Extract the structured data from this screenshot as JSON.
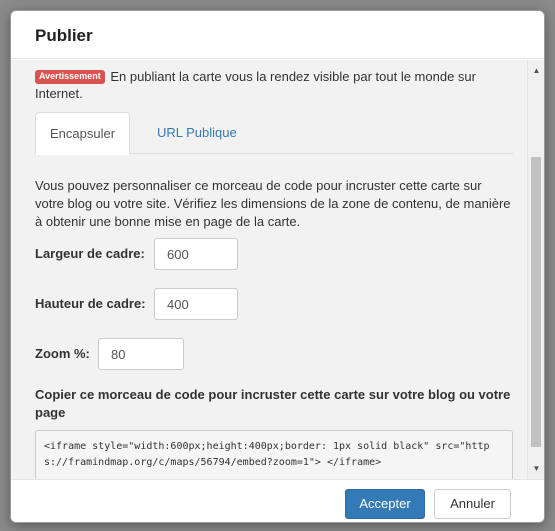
{
  "dialog": {
    "title": "Publier"
  },
  "warning": {
    "badge": "Avertissement",
    "text": "En publiant la carte vous la rendez visible par tout le monde sur Internet."
  },
  "tabs": [
    {
      "label": "Encapsuler",
      "active": true
    },
    {
      "label": "URL Publique",
      "active": false
    }
  ],
  "embed": {
    "description": "Vous pouvez personnaliser ce morceau de code pour incruster cette carte sur votre blog ou votre site. Vérifiez les dimensions de la zone de contenu, de manière à obtenir une bonne mise en page de la carte.",
    "width_label": "Largeur de cadre:",
    "width_value": "600",
    "height_label": "Hauteur de cadre:",
    "height_value": "400",
    "zoom_label": "Zoom %:",
    "zoom_value": "80",
    "copy_label": "Copier ce morceau de code pour incruster cette carte sur votre blog ou votre page",
    "code": "<iframe style=\"width:600px;height:400px;border: 1px solid black\" src=\"https://framindmap.org/c/maps/56794/embed?zoom=1\"> </iframe>"
  },
  "footer": {
    "accept_label": "Accepter",
    "cancel_label": "Annuler"
  },
  "icons": {
    "scroll_up": "scroll-up-arrow-icon",
    "scroll_down": "scroll-down-arrow-icon"
  },
  "colors": {
    "primary": "#337ab7",
    "danger": "#d9534f"
  }
}
